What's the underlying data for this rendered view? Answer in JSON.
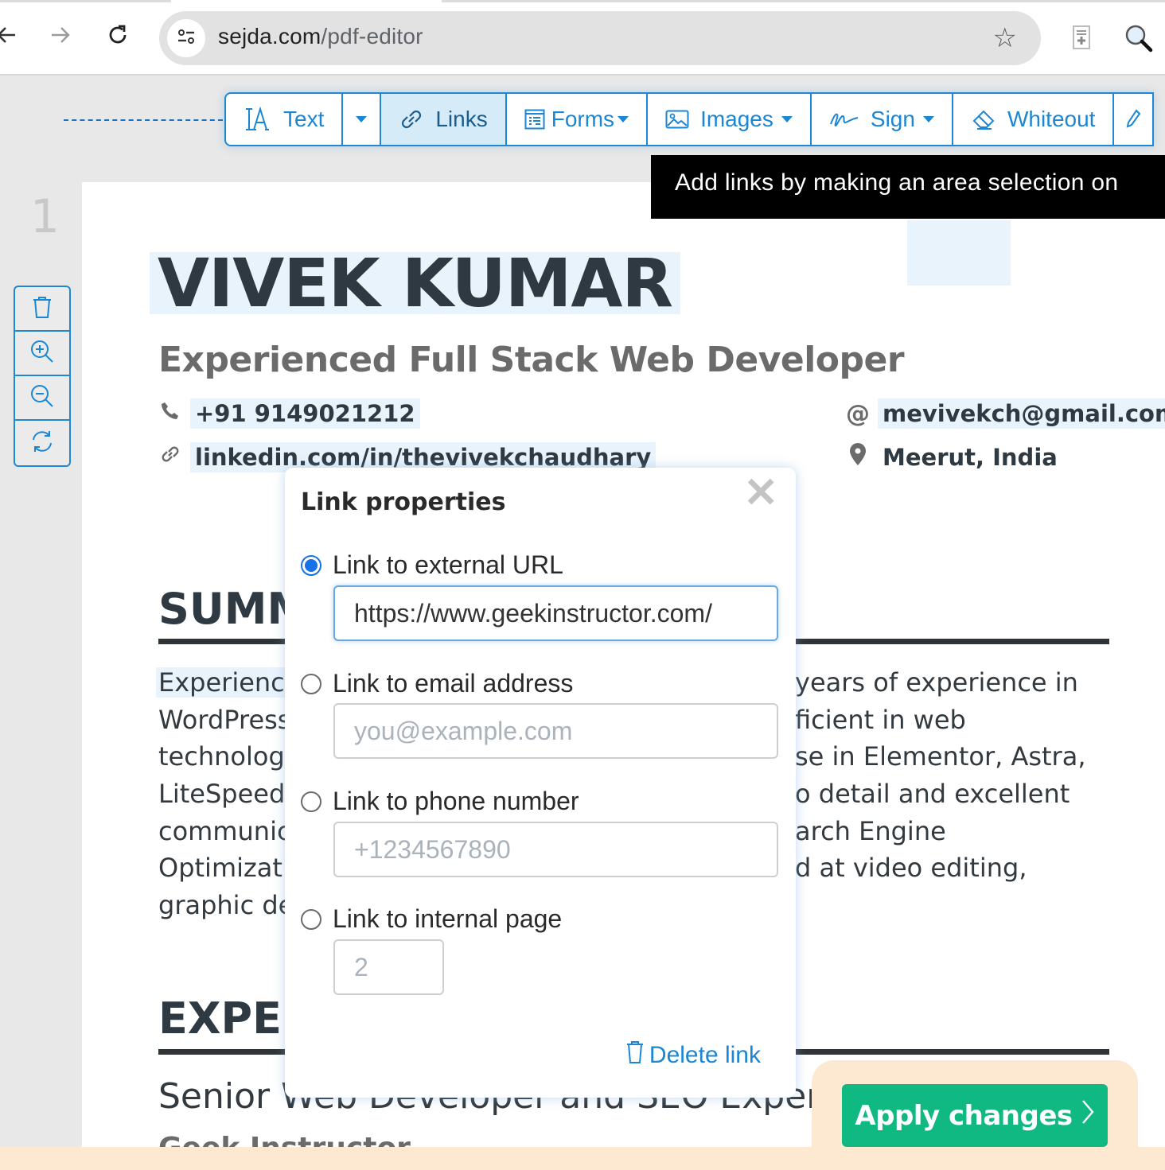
{
  "browser": {
    "url_domain": "sejda.com",
    "url_path": "/pdf-editor"
  },
  "toolbar": {
    "items": [
      {
        "label": "Text",
        "icon": "text-cursor-icon",
        "active": false
      },
      {
        "label": "Links",
        "icon": "link-icon",
        "active": true
      },
      {
        "label": "Forms",
        "icon": "form-icon",
        "active": false
      },
      {
        "label": "Images",
        "icon": "image-icon",
        "active": false
      },
      {
        "label": "Sign",
        "icon": "signature-icon",
        "active": false
      },
      {
        "label": "Whiteout",
        "icon": "eraser-icon",
        "active": false
      }
    ]
  },
  "tooltip": {
    "text": "Add links by making an area selection on"
  },
  "page": {
    "number": "1"
  },
  "side_tools": [
    "delete-page",
    "zoom-in",
    "zoom-out",
    "rotate"
  ],
  "resume": {
    "name": "VIVEK KUMAR",
    "headline": "Experienced Full Stack Web Developer",
    "phone": "+91 9149021212",
    "email": "mevivekch@gmail.com",
    "linkedin": "linkedin.com/in/thevivekchaudhary",
    "location": "Meerut, India",
    "summary_heading": "SUMM",
    "summary_left": [
      "Experienc",
      "WordPress",
      "technolog",
      "LiteSpeed",
      "communic",
      "Optimizati",
      "graphic de"
    ],
    "summary_right": [
      " years of experience in",
      "ficient in web",
      "se in Elementor, Astra,",
      "o detail and excellent",
      "arch Engine",
      "d at video editing,"
    ],
    "experience_heading": "EXPER",
    "job_title": "Senior Web Developer and SEO Expert",
    "company": "Geek Instructor"
  },
  "modal": {
    "title": "Link properties",
    "close_label": "✕",
    "options": [
      {
        "label": "Link to external URL",
        "checked": true,
        "value": "https://www.geekinstructor.com/",
        "placeholder": ""
      },
      {
        "label": "Link to email address",
        "checked": false,
        "value": "",
        "placeholder": "you@example.com"
      },
      {
        "label": "Link to phone number",
        "checked": false,
        "value": "",
        "placeholder": "+1234567890"
      },
      {
        "label": "Link to internal page",
        "checked": false,
        "value": "",
        "placeholder": "2"
      }
    ],
    "delete_label": "Delete link"
  },
  "apply": {
    "label": "Apply changes",
    "accent": "#10b981"
  },
  "colors": {
    "primary_blue": "#1e88d4",
    "active_tab_bg": "#d6ebf8"
  }
}
